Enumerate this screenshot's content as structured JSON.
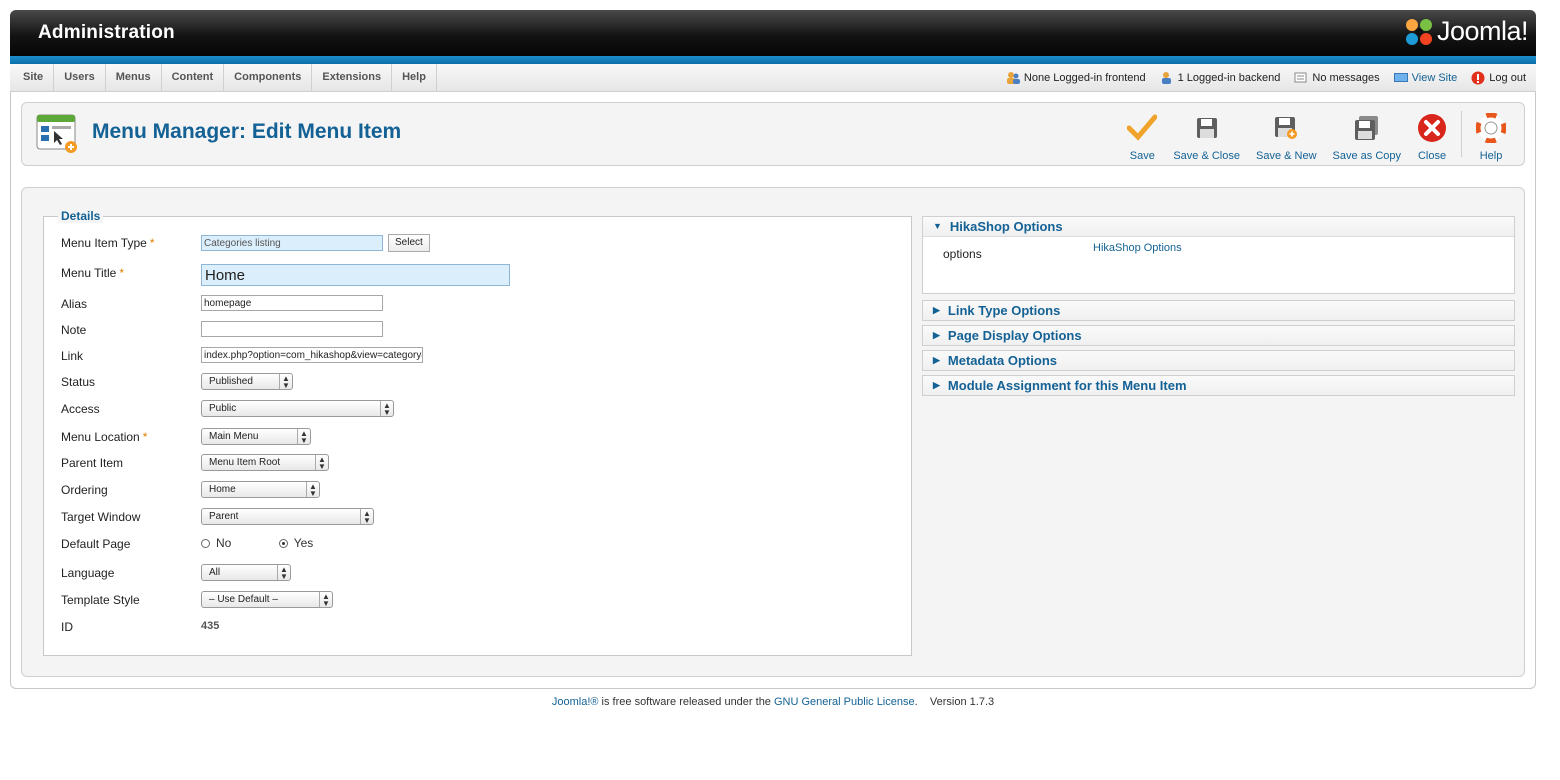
{
  "header": {
    "title": "Administration",
    "logo_text": "Joomla!"
  },
  "mainmenu": [
    {
      "label": "Site"
    },
    {
      "label": "Users"
    },
    {
      "label": "Menus"
    },
    {
      "label": "Content"
    },
    {
      "label": "Components"
    },
    {
      "label": "Extensions"
    },
    {
      "label": "Help"
    }
  ],
  "status": {
    "frontend": "None Logged-in frontend",
    "backend": "1 Logged-in backend",
    "messages": "No messages",
    "view_site": "View Site",
    "logout": "Log out"
  },
  "page": {
    "title": "Menu Manager: Edit Menu Item"
  },
  "toolbar": {
    "save": "Save",
    "save_close": "Save & Close",
    "save_new": "Save & New",
    "save_copy": "Save as Copy",
    "close": "Close",
    "help": "Help"
  },
  "details": {
    "legend": "Details",
    "menu_item_type": {
      "label": "Menu Item Type",
      "value": "Categories listing",
      "button": "Select"
    },
    "menu_title": {
      "label": "Menu Title",
      "value": "Home"
    },
    "alias": {
      "label": "Alias",
      "value": "homepage"
    },
    "note": {
      "label": "Note",
      "value": ""
    },
    "link": {
      "label": "Link",
      "value": "index.php?option=com_hikashop&view=category&layout=listing"
    },
    "status": {
      "label": "Status",
      "value": "Published"
    },
    "access": {
      "label": "Access",
      "value": "Public"
    },
    "menu_location": {
      "label": "Menu Location",
      "value": "Main Menu"
    },
    "parent_item": {
      "label": "Parent Item",
      "value": "Menu Item Root"
    },
    "ordering": {
      "label": "Ordering",
      "value": "Home"
    },
    "target_window": {
      "label": "Target Window",
      "value": "Parent"
    },
    "default_page": {
      "label": "Default Page",
      "no": "No",
      "yes": "Yes",
      "selected": "Yes"
    },
    "language": {
      "label": "Language",
      "value": "All"
    },
    "template_style": {
      "label": "Template Style",
      "value": "– Use Default –"
    },
    "id": {
      "label": "ID",
      "value": "435"
    },
    "required_mark": "*"
  },
  "panes": {
    "hikashop": {
      "title": "HikaShop Options",
      "field_label": "options",
      "field_link": "HikaShop Options"
    },
    "link_type": "Link Type Options",
    "page_display": "Page Display Options",
    "metadata": "Metadata Options",
    "module_assignment": "Module Assignment for this Menu Item"
  },
  "footer": {
    "joomla": "Joomla!®",
    "text": " is free software released under the ",
    "license": "GNU General Public License",
    "period": ".",
    "version": "Version 1.7.3"
  },
  "colors": {
    "link": "#146295",
    "header_band": "#0a6ea9",
    "required": "#e07f00",
    "close": "#d9261c"
  }
}
